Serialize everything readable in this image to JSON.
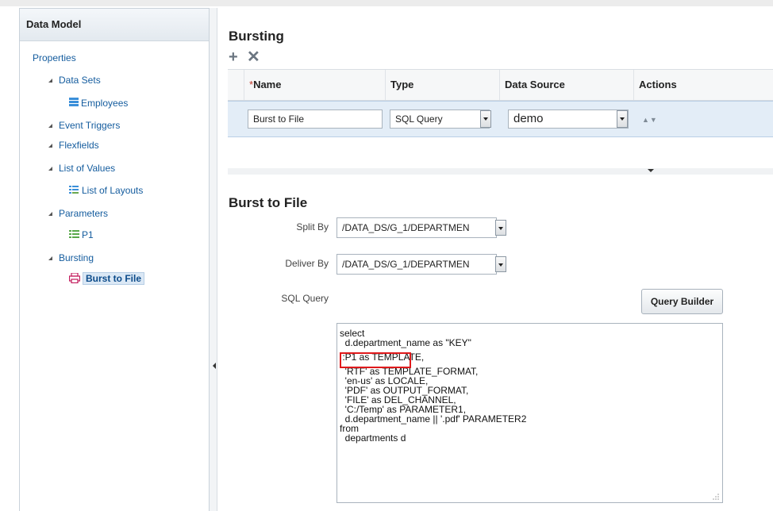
{
  "left_panel": {
    "title": "Data Model",
    "items": [
      {
        "label": "Properties"
      },
      {
        "label": "Data Sets"
      },
      {
        "label": "Employees"
      },
      {
        "label": "Event Triggers"
      },
      {
        "label": "Flexfields"
      },
      {
        "label": "List of Values"
      },
      {
        "label": "List of Layouts"
      },
      {
        "label": "Parameters"
      },
      {
        "label": "P1"
      },
      {
        "label": "Bursting"
      },
      {
        "label": "Burst to File"
      }
    ]
  },
  "bursting": {
    "title": "Bursting",
    "toolbar": {
      "add": "+",
      "delete": "✕"
    },
    "columns": {
      "required_mark": "*",
      "name": "Name",
      "type": "Type",
      "data_source": "Data Source",
      "actions": "Actions"
    },
    "row": {
      "name": "Burst to File",
      "type": "SQL Query",
      "data_source": "demo"
    }
  },
  "detail": {
    "title": "Burst to File",
    "split_by_label": "Split By",
    "split_by_value": "/DATA_DS/G_1/DEPARTMEN",
    "deliver_by_label": "Deliver By",
    "deliver_by_value": "/DATA_DS/G_1/DEPARTMEN",
    "sql_label": "SQL Query",
    "query_builder": "Query Builder",
    "sql_lines": [
      "select",
      "  d.department_name as \"KEY\"",
      "",
      " :P1 as TEMPLATE,",
      "",
      "  'RTF' as TEMPLATE_FORMAT,",
      "  'en-us' as LOCALE,",
      "  'PDF' as OUTPUT_FORMAT,",
      "  'FILE' as DEL_CHANNEL,",
      "  'C:/Temp' as PARAMETER1,",
      "  d.department_name || '.pdf' PARAMETER2",
      "from",
      "  departments d"
    ]
  },
  "colors": {
    "accent": "#145c9e",
    "highlight_box": "#e0191b",
    "selected_row": "#e3edf7"
  }
}
